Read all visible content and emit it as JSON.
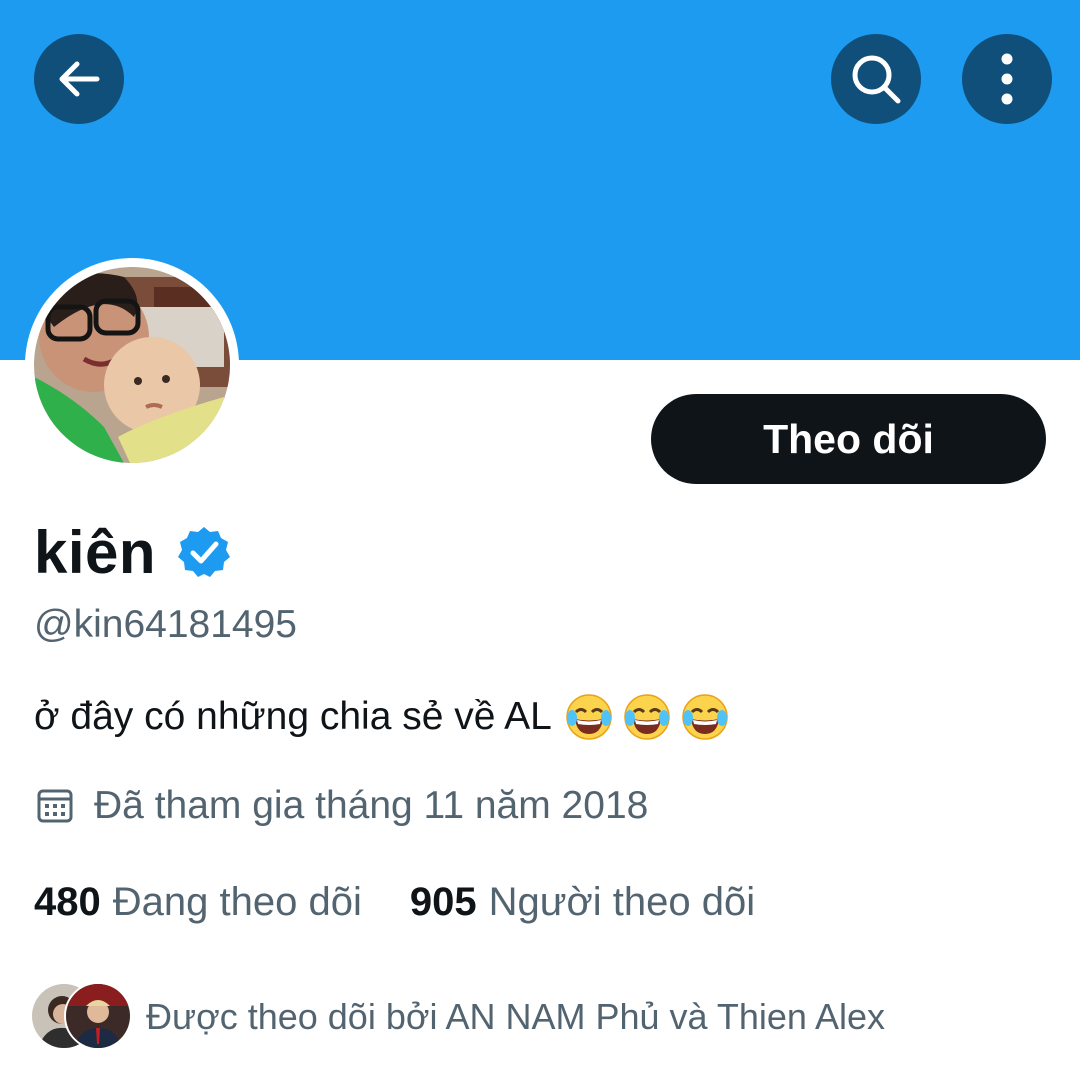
{
  "header": {
    "back_icon": "arrow-left-icon",
    "search_icon": "search-icon",
    "more_icon": "more-vertical-icon",
    "banner_color": "#1d9bf0"
  },
  "profile": {
    "display_name": "kiên",
    "verified_icon": "verified-badge-icon",
    "handle": "@kin64181495",
    "bio": "ở đây có những chia sẻ về AL",
    "bio_emojis": [
      "face-with-tears-of-joy",
      "face-with-tears-of-joy",
      "face-with-tears-of-joy"
    ],
    "joined": "Đã tham gia tháng 11 năm 2018",
    "following_count": "480",
    "following_label": "Đang theo dõi",
    "followers_count": "905",
    "followers_label": "Người theo dõi",
    "followed_by": "Được theo dõi bởi AN NAM Phủ và Thien Alex"
  },
  "actions": {
    "follow_label": "Theo dõi"
  }
}
